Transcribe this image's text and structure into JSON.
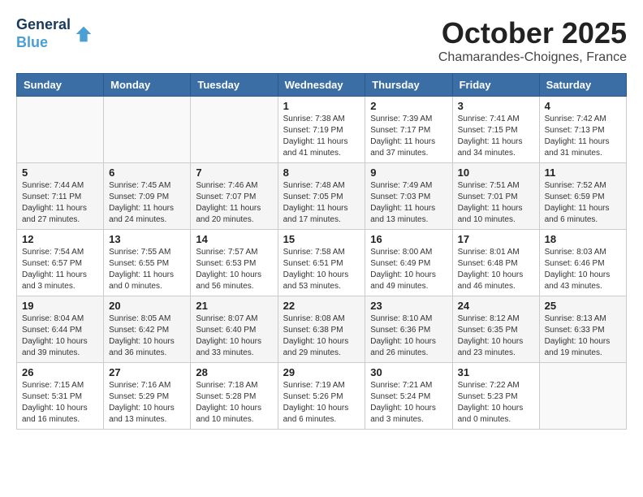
{
  "header": {
    "logo_line1": "General",
    "logo_line2": "Blue",
    "month": "October 2025",
    "location": "Chamarandes-Choignes, France"
  },
  "weekdays": [
    "Sunday",
    "Monday",
    "Tuesday",
    "Wednesday",
    "Thursday",
    "Friday",
    "Saturday"
  ],
  "weeks": [
    [
      {
        "day": "",
        "content": ""
      },
      {
        "day": "",
        "content": ""
      },
      {
        "day": "",
        "content": ""
      },
      {
        "day": "1",
        "content": "Sunrise: 7:38 AM\nSunset: 7:19 PM\nDaylight: 11 hours and 41 minutes."
      },
      {
        "day": "2",
        "content": "Sunrise: 7:39 AM\nSunset: 7:17 PM\nDaylight: 11 hours and 37 minutes."
      },
      {
        "day": "3",
        "content": "Sunrise: 7:41 AM\nSunset: 7:15 PM\nDaylight: 11 hours and 34 minutes."
      },
      {
        "day": "4",
        "content": "Sunrise: 7:42 AM\nSunset: 7:13 PM\nDaylight: 11 hours and 31 minutes."
      }
    ],
    [
      {
        "day": "5",
        "content": "Sunrise: 7:44 AM\nSunset: 7:11 PM\nDaylight: 11 hours and 27 minutes."
      },
      {
        "day": "6",
        "content": "Sunrise: 7:45 AM\nSunset: 7:09 PM\nDaylight: 11 hours and 24 minutes."
      },
      {
        "day": "7",
        "content": "Sunrise: 7:46 AM\nSunset: 7:07 PM\nDaylight: 11 hours and 20 minutes."
      },
      {
        "day": "8",
        "content": "Sunrise: 7:48 AM\nSunset: 7:05 PM\nDaylight: 11 hours and 17 minutes."
      },
      {
        "day": "9",
        "content": "Sunrise: 7:49 AM\nSunset: 7:03 PM\nDaylight: 11 hours and 13 minutes."
      },
      {
        "day": "10",
        "content": "Sunrise: 7:51 AM\nSunset: 7:01 PM\nDaylight: 11 hours and 10 minutes."
      },
      {
        "day": "11",
        "content": "Sunrise: 7:52 AM\nSunset: 6:59 PM\nDaylight: 11 hours and 6 minutes."
      }
    ],
    [
      {
        "day": "12",
        "content": "Sunrise: 7:54 AM\nSunset: 6:57 PM\nDaylight: 11 hours and 3 minutes."
      },
      {
        "day": "13",
        "content": "Sunrise: 7:55 AM\nSunset: 6:55 PM\nDaylight: 11 hours and 0 minutes."
      },
      {
        "day": "14",
        "content": "Sunrise: 7:57 AM\nSunset: 6:53 PM\nDaylight: 10 hours and 56 minutes."
      },
      {
        "day": "15",
        "content": "Sunrise: 7:58 AM\nSunset: 6:51 PM\nDaylight: 10 hours and 53 minutes."
      },
      {
        "day": "16",
        "content": "Sunrise: 8:00 AM\nSunset: 6:49 PM\nDaylight: 10 hours and 49 minutes."
      },
      {
        "day": "17",
        "content": "Sunrise: 8:01 AM\nSunset: 6:48 PM\nDaylight: 10 hours and 46 minutes."
      },
      {
        "day": "18",
        "content": "Sunrise: 8:03 AM\nSunset: 6:46 PM\nDaylight: 10 hours and 43 minutes."
      }
    ],
    [
      {
        "day": "19",
        "content": "Sunrise: 8:04 AM\nSunset: 6:44 PM\nDaylight: 10 hours and 39 minutes."
      },
      {
        "day": "20",
        "content": "Sunrise: 8:05 AM\nSunset: 6:42 PM\nDaylight: 10 hours and 36 minutes."
      },
      {
        "day": "21",
        "content": "Sunrise: 8:07 AM\nSunset: 6:40 PM\nDaylight: 10 hours and 33 minutes."
      },
      {
        "day": "22",
        "content": "Sunrise: 8:08 AM\nSunset: 6:38 PM\nDaylight: 10 hours and 29 minutes."
      },
      {
        "day": "23",
        "content": "Sunrise: 8:10 AM\nSunset: 6:36 PM\nDaylight: 10 hours and 26 minutes."
      },
      {
        "day": "24",
        "content": "Sunrise: 8:12 AM\nSunset: 6:35 PM\nDaylight: 10 hours and 23 minutes."
      },
      {
        "day": "25",
        "content": "Sunrise: 8:13 AM\nSunset: 6:33 PM\nDaylight: 10 hours and 19 minutes."
      }
    ],
    [
      {
        "day": "26",
        "content": "Sunrise: 7:15 AM\nSunset: 5:31 PM\nDaylight: 10 hours and 16 minutes."
      },
      {
        "day": "27",
        "content": "Sunrise: 7:16 AM\nSunset: 5:29 PM\nDaylight: 10 hours and 13 minutes."
      },
      {
        "day": "28",
        "content": "Sunrise: 7:18 AM\nSunset: 5:28 PM\nDaylight: 10 hours and 10 minutes."
      },
      {
        "day": "29",
        "content": "Sunrise: 7:19 AM\nSunset: 5:26 PM\nDaylight: 10 hours and 6 minutes."
      },
      {
        "day": "30",
        "content": "Sunrise: 7:21 AM\nSunset: 5:24 PM\nDaylight: 10 hours and 3 minutes."
      },
      {
        "day": "31",
        "content": "Sunrise: 7:22 AM\nSunset: 5:23 PM\nDaylight: 10 hours and 0 minutes."
      },
      {
        "day": "",
        "content": ""
      }
    ]
  ]
}
